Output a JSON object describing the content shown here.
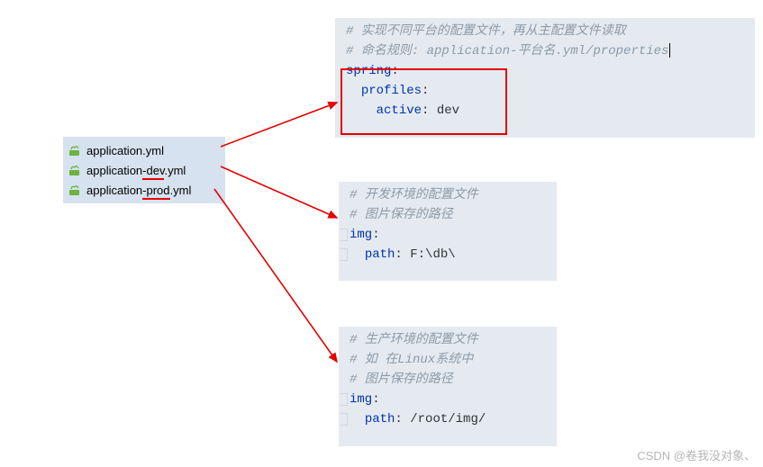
{
  "files": [
    {
      "label": "application.yml"
    },
    {
      "label_pre": "application",
      "label_mid": "-dev",
      "label_post": ".yml"
    },
    {
      "label_pre": "application",
      "label_mid": "-prod",
      "label_post": ".yml"
    }
  ],
  "block1": {
    "c1": "# 实现不同平台的配置文件，再从主配置文件读取",
    "c2a": "# 命名规则: ",
    "c2b": "application-",
    "c2c": "平台名",
    "c2d": ".yml/properties",
    "k1": "spring",
    "k2": "profiles",
    "k3": "active",
    "v3": "dev"
  },
  "block2": {
    "c1": "# 开发环境的配置文件",
    "c2": "# 图片保存的路径",
    "k1": "img",
    "k2": "path",
    "v2": "F:\\db\\"
  },
  "block3": {
    "c1": "# 生产环境的配置文件",
    "c2": "# 如 在Linux系统中",
    "c3": "# 图片保存的路径",
    "k1": "img",
    "k2": "path",
    "v2": "/root/img/"
  },
  "watermark": "CSDN @卷我没对象、"
}
